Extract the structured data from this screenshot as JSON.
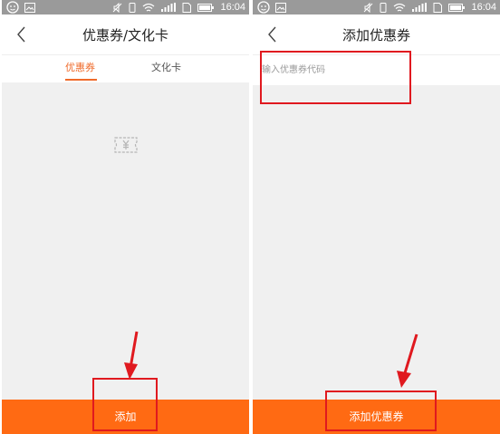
{
  "left_screen": {
    "status": {
      "time": "16:04"
    },
    "nav": {
      "title": "优惠券/文化卡"
    },
    "tabs": [
      {
        "label": "优惠券",
        "active": true
      },
      {
        "label": "文化卡",
        "active": false
      }
    ],
    "empty_icon": "coupon-yen-icon",
    "bottom_button": {
      "label": "添加"
    }
  },
  "right_screen": {
    "status": {
      "time": "16:04"
    },
    "nav": {
      "title": "添加优惠券"
    },
    "input": {
      "placeholder": "输入优惠券代码",
      "value": ""
    },
    "bottom_button": {
      "label": "添加优惠券"
    }
  },
  "colors": {
    "accent": "#ff6a13",
    "tab_active": "#ef6a2a",
    "annotation_red": "#e0191f",
    "statusbar": "#9a9a9a",
    "content_bg": "#f0f0f0"
  },
  "icons": [
    "face-icon",
    "image-icon",
    "mute-icon",
    "vibrate-icon",
    "wifi-icon",
    "signal-icon",
    "sim-icon",
    "battery-icon",
    "back-arrow-icon",
    "coupon-yen-icon"
  ]
}
